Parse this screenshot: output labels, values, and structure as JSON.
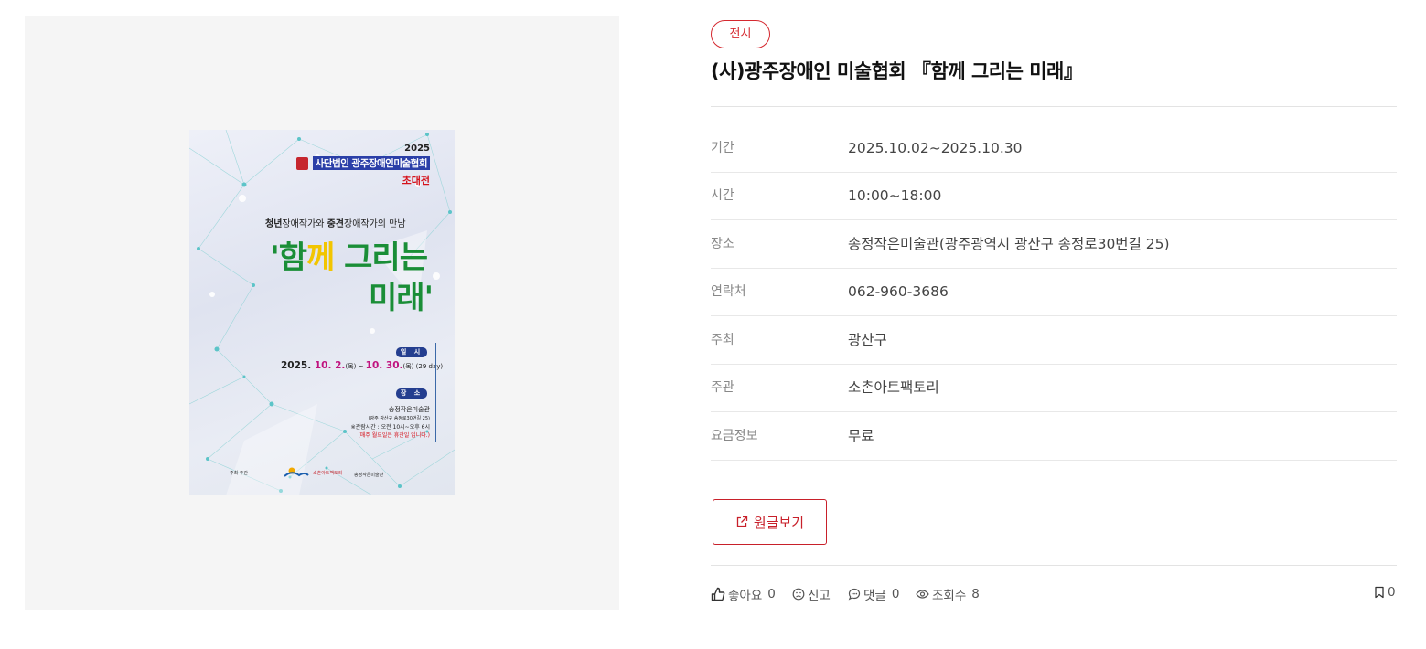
{
  "category": "전시",
  "title": "(사)광주장애인 미술협회 『함께 그리는 미래』",
  "poster": {
    "year": "2025",
    "association": "사단법인 광주장애인미술협회",
    "invitation": "초대전",
    "subtitle_a": "청년",
    "subtitle_b": "장애작가와 ",
    "subtitle_c": "중견",
    "subtitle_d": "장애작가의 만남",
    "title_q1": "'",
    "title_w1": "함",
    "title_w2": "께",
    "title_w3": " 그리는",
    "title_line2": "미래'",
    "period_label": "일 시",
    "date_a": "2025. ",
    "date_b": "10. 2.",
    "date_c": "(목) ~ ",
    "date_d": "10. 30.",
    "date_e": "(목) (29 day)",
    "venue_label": "장 소",
    "venue_name": "송정작은미술관",
    "venue_address": "(광주 광산구 송정로30번길 25)",
    "hours": "※관람시간 : 오전 10시~오후 6시",
    "closed": "(매주 월요일은 휴관일 입니다.)",
    "sponsor_label": "주최·주관",
    "sponsor_2": "소촌아트팩토리",
    "sponsor_3": "송정작은미술관"
  },
  "info_rows": [
    {
      "label": "기간",
      "value": "2025.10.02~2025.10.30"
    },
    {
      "label": "시간",
      "value": "10:00~18:00"
    },
    {
      "label": "장소",
      "value": "송정작은미술관(광주광역시 광산구 송정로30번길 25)"
    },
    {
      "label": "연락처",
      "value": "062-960-3686"
    },
    {
      "label": "주최",
      "value": "광산구"
    },
    {
      "label": "주관",
      "value": "소촌아트팩토리"
    },
    {
      "label": "요금정보",
      "value": "무료"
    }
  ],
  "original_button_label": "원글보기",
  "stats": {
    "like_label": "좋아요",
    "like_count": "0",
    "report_label": "신고",
    "comment_label": "댓글",
    "comment_count": "0",
    "view_label": "조회수",
    "view_count": "8",
    "bookmark_count": "0"
  },
  "colors": {
    "accent": "#d5282f",
    "poster_title_green": "#1a8e37",
    "poster_title_yellow": "#f2c500",
    "poster_date_magenta": "#c0137f",
    "poster_navy": "#243e8f"
  },
  "icons": [
    "external-link-icon",
    "like-icon",
    "report-icon",
    "comment-icon",
    "eye-icon",
    "bookmark-icon"
  ]
}
